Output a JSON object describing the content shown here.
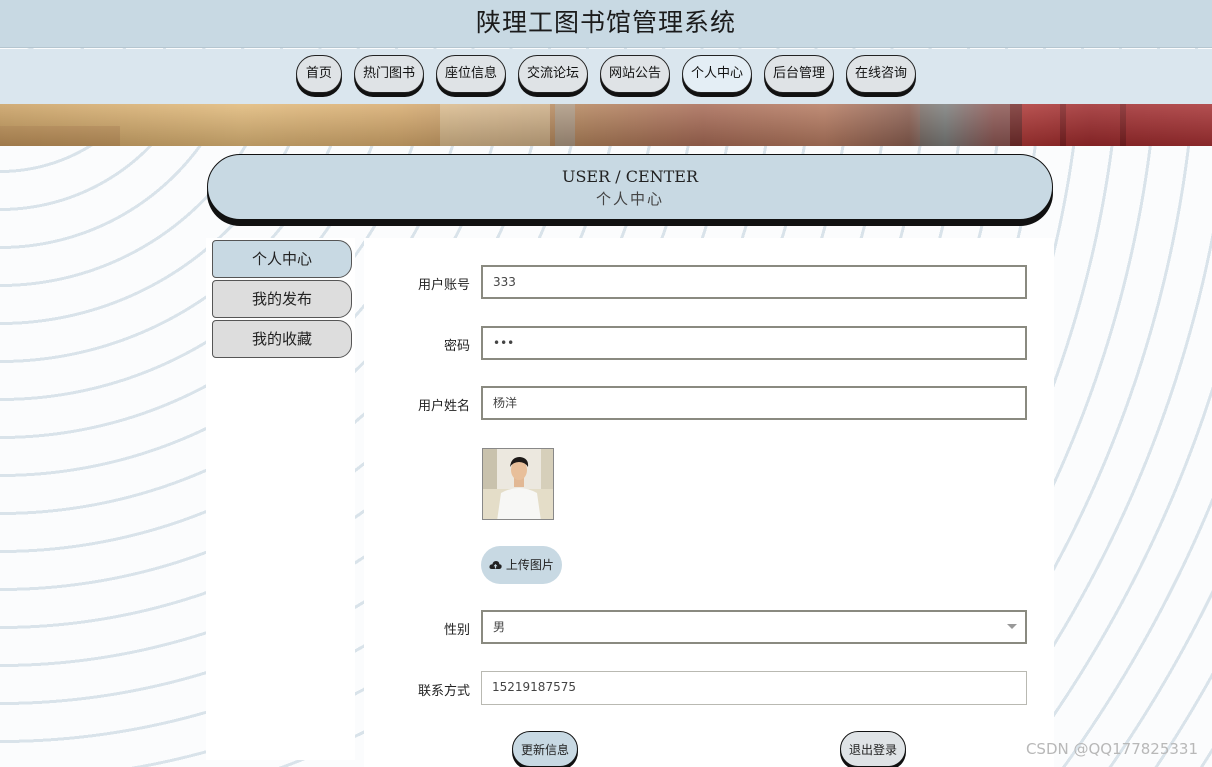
{
  "header": {
    "title": "陕理工图书馆管理系统"
  },
  "nav": {
    "items": [
      {
        "label": "首页"
      },
      {
        "label": "热门图书"
      },
      {
        "label": "座位信息"
      },
      {
        "label": "交流论坛"
      },
      {
        "label": "网站公告"
      },
      {
        "label": "个人中心",
        "active": true
      },
      {
        "label": "后台管理"
      },
      {
        "label": "在线咨询"
      }
    ]
  },
  "center_header": {
    "en": "USER / CENTER",
    "cn": "个人中心"
  },
  "sidebar": {
    "items": [
      {
        "label": "个人中心",
        "active": true
      },
      {
        "label": "我的发布"
      },
      {
        "label": "我的收藏"
      }
    ]
  },
  "form": {
    "account_label": "用户账号",
    "account_value": "333",
    "password_label": "密码",
    "password_value": "•••",
    "name_label": "用户姓名",
    "name_value": "杨洋",
    "upload_label": "上传图片",
    "gender_label": "性别",
    "gender_value": "男",
    "contact_label": "联系方式",
    "contact_value": "15219187575"
  },
  "buttons": {
    "update_label": "更新信息",
    "logout_label": "退出登录"
  },
  "watermark": "CSDN @QQ177825331",
  "colors": {
    "accent": "#c8d9e3",
    "nav_bg": "#dae6ee",
    "button_grey": "#dfe3e6"
  },
  "icons": {
    "upload": "cloud-upload-icon",
    "select": "chevron-down-icon"
  }
}
